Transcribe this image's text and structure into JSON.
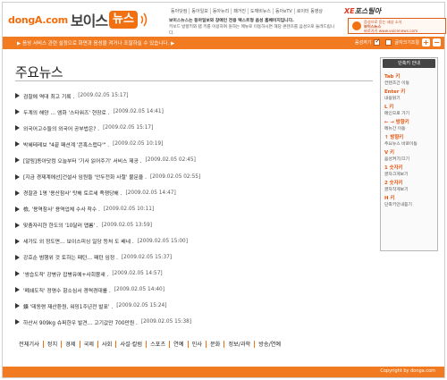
{
  "header": {
    "logo_donga": "dongA.com",
    "logo_voice": "보이스",
    "logo_news": "뉴스",
    "topnav": [
      "동아닷컴",
      "동아일보",
      "동아뉴리",
      "패거진",
      "도깨비뉴스",
      "동아eTV",
      "로이터 동영상"
    ],
    "brand2_a": "XE",
    "brand2_b": "포스틸아",
    "desc_line1": "보이스뉴스는 동아일보와 장애인 전용 텍스트형 음성 홈페이지입니다.",
    "desc_line2": "키보드 방향키와 탭 키를 이용하여 원하는 메뉴로 이동하시면 해당 콘텐츠를 음성으로 들려드립니다.",
    "promo_line1": "음성으로 듣는 세상 소식",
    "promo_line2": "보이스뉴스",
    "promo_line3": "바로가기 www.voicenews.com"
  },
  "bar": {
    "message": "▶ 음성 서비스 관련 설정으로 화면과 음성을 켜거나 조절하실 수 있습니다. ▶",
    "voice_label": "음성켜기",
    "font_label": "글자크기조절",
    "plus": "+",
    "minus": "−"
  },
  "main": {
    "title": "주요뉴스",
    "news": [
      {
        "title": "검찰에 역대 최고 기록 .",
        "date": "[2009.02.05 15:17]"
      },
      {
        "title": "두계의 해양 … 엠화 '스타워즈' 현장로 .",
        "date": "[2009.02.05 14:41]"
      },
      {
        "title": "외국어고수들의 외국어 공부법은? .",
        "date": "[2009.02.05 15:17]"
      },
      {
        "title": "박혜테레보 \"4끝 패션계 '콘혹스럽다'\" .",
        "date": "[2009.02.05 10:19]"
      },
      {
        "title": "[알림]동아닷컴 오늘부터 '기사 읽어주기' 서비스 제공 .",
        "date": "[2009.02.05 02:45]"
      },
      {
        "title": "[지금 경제계에선]건설사 임원들 '안두전화 사절' 불문율 .",
        "date": "[2009.02.05 02:55]"
      },
      {
        "title": "경찰관 1명 '용산참사' 탓해 토르세 족쟁당해 .",
        "date": "[2009.02.05 14:47]"
      },
      {
        "title": "檢, '용역참사' 용역업체 수사 착수 .",
        "date": "[2009.02.05 10:11]"
      },
      {
        "title": "맞춤자리한 한도의 '10달러 맵롬' .",
        "date": "[2009.02.05 13:59]"
      },
      {
        "title": "세가도 외 정도면… 보이스피싱 일당 등처 도 배네 .",
        "date": "[2009.02.05 15:00]"
      },
      {
        "title": "강호순 범행위 것 토하는 패턴… 패턴 임정 .",
        "date": "[2009.02.05 15:37]"
      },
      {
        "title": "'쌍습도작' 강병규 잡병유에+사회뮹새 .",
        "date": "[2009.02.05 14:57]"
      },
      {
        "title": "'폐쇄도직' 정명수 항소심서 경력경대를 .",
        "date": "[2009.02.05 14:40]"
      },
      {
        "title": "鑛 '데동령 재산환원, 워밍1주년전 발표' .",
        "date": "[2009.02.05 15:24]"
      },
      {
        "title": "하산서 909kg 슈퍼한우 발견… 고기값만 700만원 .",
        "date": "[2009.02.05 15:38]"
      }
    ]
  },
  "keyguide": {
    "title": "단축키 안내",
    "items": [
      {
        "key": "Tab 키",
        "desc": "컨텐츠간 이동"
      },
      {
        "key": "Enter 키",
        "desc": "내용읽기"
      },
      {
        "key": "L 키",
        "desc": "메인으로 가기"
      },
      {
        "key": "← → 방향키",
        "desc": "메뉴간 이동"
      },
      {
        "key": "↑ 방향키",
        "desc": "주요뉴스 바로이동"
      },
      {
        "key": "V 키",
        "desc": "음성켜기/끄기"
      },
      {
        "key": "1 숫자키",
        "desc": "글자크게보기"
      },
      {
        "key": "2 숫자키",
        "desc": "글자작게보기"
      },
      {
        "key": "H 키",
        "desc": "단축키안내듣기"
      }
    ]
  },
  "bottom_nav": [
    "전체기사",
    "정치",
    "경제",
    "국제",
    "사회",
    "사설·칼럼",
    "스포츠",
    "연예",
    "인사",
    "문화",
    "정보/과학",
    "방송/연예"
  ],
  "footer": {
    "copyright": "Copyright by donga.com"
  },
  "colors": {
    "accent": "#f27a21",
    "key": "#e55610"
  }
}
